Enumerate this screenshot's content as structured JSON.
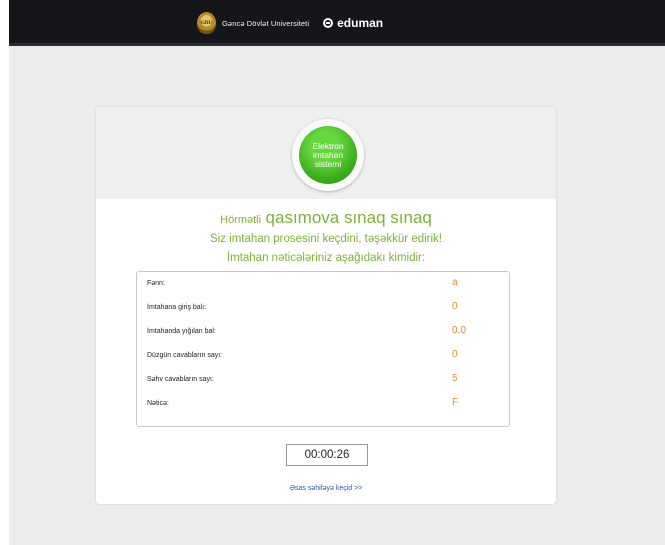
{
  "header": {
    "logo_letters": "GDU",
    "university_name": "Gəncə Dövlət Universiteti",
    "product_name": "eduman"
  },
  "badge": {
    "label": "Elektron imtahan sistemi"
  },
  "greeting": {
    "prefix": "Hörmətli",
    "name": "qasımova sınaq sınaq",
    "thanks": "Siz imtahan prosesini keçdini, təşəkkür edirik!",
    "results_intro": "İmtahan nəticələriniz aşağıdakı kimidir:"
  },
  "results": [
    {
      "label": "Fənn:",
      "value": "a"
    },
    {
      "label": "İmtahana giriş balı:",
      "value": "0"
    },
    {
      "label": "İmtahanda yığılan bal:",
      "value": "0.0"
    },
    {
      "label": "Düzgün cavabların sayı:",
      "value": "0"
    },
    {
      "label": "Səhv cavabların sayı:",
      "value": "5"
    },
    {
      "label": "Nəticə:",
      "value": "F"
    }
  ],
  "timer": "00:00:26",
  "home_link": "Əsas səhifəyə keçid >>",
  "colors": {
    "accent_green": "#7ab23a",
    "value_orange": "#e8893a",
    "link_blue": "#2f5da0",
    "topbar": "#15161a"
  }
}
